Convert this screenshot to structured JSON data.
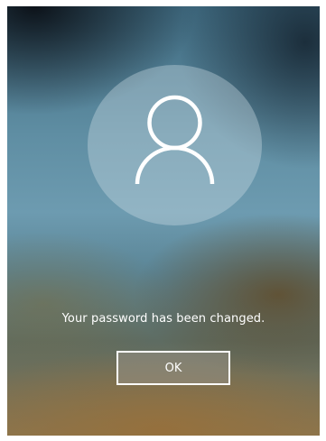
{
  "login_screen": {
    "avatar_icon": "user-icon",
    "message": "Your password has been changed.",
    "ok_label": "OK"
  }
}
